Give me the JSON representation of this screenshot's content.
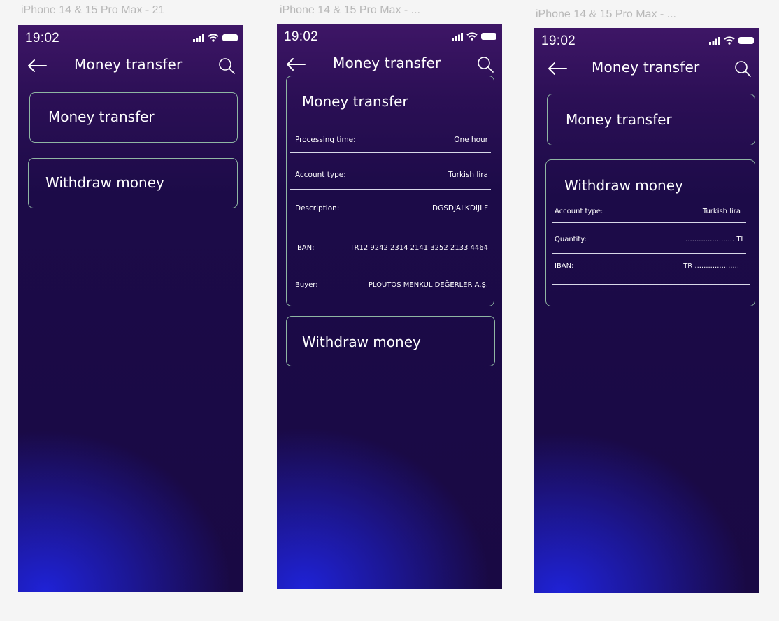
{
  "frames": [
    {
      "label": "iPhone 14 & 15 Pro Max - 21",
      "time": "19:02",
      "nav_title": "Money transfer",
      "cards": [
        {
          "title": "Money transfer"
        },
        {
          "title": "Withdraw money"
        }
      ]
    },
    {
      "label": "iPhone 14 & 15 Pro Max - ...",
      "time": "19:02",
      "nav_title": "Money transfer",
      "money_transfer": {
        "title": "Money transfer",
        "rows": [
          {
            "label": "Processing time:",
            "value": "One hour"
          },
          {
            "label": "Account type:",
            "value": "Turkish lira"
          },
          {
            "label": "Description:",
            "value": "DGSDJALKDIJLF"
          },
          {
            "label": "IBAN:",
            "value": "TR12 9242 2314 2141 3252 2133 4464"
          },
          {
            "label": "Buyer:",
            "value": "PLOUTOS MENKUL DEĞERLER A.Ş."
          }
        ]
      },
      "withdraw_card": {
        "title": "Withdraw money"
      }
    },
    {
      "label": "iPhone 14 & 15 Pro Max - ...",
      "time": "19:02",
      "nav_title": "Money transfer",
      "money_transfer_card": {
        "title": "Money transfer"
      },
      "withdraw": {
        "title": "Withdraw money",
        "rows": [
          {
            "label": "Account type:",
            "value": "Turkish lira"
          },
          {
            "label": "Quantity:",
            "value": "...................... TL"
          },
          {
            "label": "IBAN:",
            "value": "TR ...................."
          }
        ]
      }
    }
  ],
  "icons": {
    "back": "arrow-left-icon",
    "search": "magnifier-icon",
    "signal": "cellular-signal-icon",
    "wifi": "wifi-icon",
    "battery": "battery-icon"
  },
  "colors": {
    "canvas_bg": "#f5f5f5",
    "frame_top": "#3e1666",
    "frame_mid": "#1c0b48",
    "frame_glow": "#1f22d6",
    "card_border": "#8fb6a3",
    "text": "#ffffff",
    "frame_label": "#b8b8b8"
  }
}
